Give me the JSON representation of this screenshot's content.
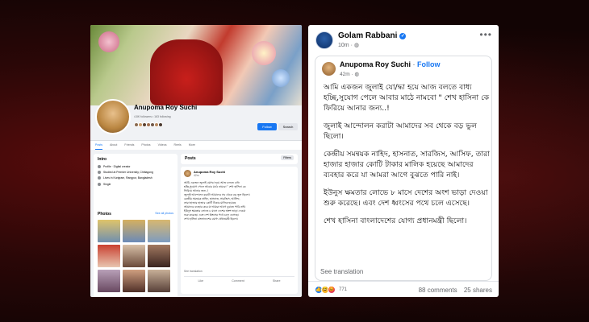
{
  "left_profile": {
    "name": "Anupoma Roy Suchi",
    "stats": "4.8K followers • 163 following",
    "follow_label": "Follow",
    "search_label": "Search",
    "tabs": [
      "Posts",
      "About",
      "Friends",
      "Photos",
      "Videos",
      "Reels",
      "More"
    ],
    "intro": {
      "title": "Intro",
      "items": [
        "Profile · Digital creator",
        "Studied at Premier University, Chittagong",
        "Lives in Kurigram, Rangpur, Bangladesh",
        "Single"
      ]
    },
    "photos": {
      "title": "Photos",
      "see_all": "See all photos"
    },
    "posts_title": "Posts",
    "filters_label": "Filters",
    "mini_post": {
      "author": "Anupoma Roy Suchi",
      "time": "42m",
      "lines": [
        "আমি একজন জুলাই যো/দ্ধা হয়ে আজ বলতে বাধ্য",
        "হচ্ছি,সুযোগ পেলে আবার মাঠে নামবো \" শেখ হাসিনা কে",
        "ফিরিয়ে আনার জন্য..!",
        "জুলাই আন্দোলন করাটা আমাদের সব থেকে বড় ভুল ছিলো।",
        "কেন্দ্রীয় সমন্বয়ক নাহিদ, হাসনাত, সারজিস, আসিফ,",
        "তারা হাজার হাজার কোটি টাকার মালিক হয়েছে",
        "আমাদের ব্যবহার করে যা আমরা আগে বুঝতে পারি নাই।",
        "ইউনুস ক্ষমতার লোভে ৮ মাসে দেশের অংশ ভাড়া দেওয়া",
        "শুরু করেছে। এবং দেশ ধ্বংসের পথে চলে এসেছে।",
        "শেখ হাসিনা বাংলাদেশের যোগ্য প্রধানমন্ত্রী ছিলো।"
      ],
      "see_translation": "See translation",
      "actions": [
        "Like",
        "Comment",
        "Share"
      ]
    }
  },
  "right_post": {
    "sharer": "Golam Rabbani",
    "time": "10m",
    "more_icon": "ellipsis-icon",
    "shared": {
      "author": "Anupoma Roy Suchi",
      "follow": "Follow",
      "time": "42m",
      "paragraphs": [
        "আমি একজন জুলাই যো/দ্ধা হয়ে আজ বলতে বাধ্য হচ্ছি,সুযোগ পেলে আবার মাঠে নামবো \" শেখ হাসিনা কে ফিরিয়ে আনার জন্য..!",
        "জুলাই আন্দোলন করাটা আমাদের সব থেকে বড় ভুল ছিলো।",
        "কেন্দ্রীয় সমন্বয়ক নাহিদ, হাসনাত, সারজিস, আসিফ, তারা হাজার হাজার কোটি টাকার মালিক হয়েছে আমাদের ব্যবহার করে যা আমরা আগে বুঝতে পারি নাই।",
        "ইউনুস ক্ষমতার লোভে ৮ মাসে দেশের অংশ ভাড়া দেওয়া শুরু করেছে। এবং দেশ ধ্বংসের পথে চলে এসেছে।",
        "শেখ হাসিনা বাংলাদেশের যোগ্য প্রধানমন্ত্রী ছিলো।"
      ],
      "see_translation": "See translation"
    },
    "reactions_count": "771",
    "comments": "88 comments",
    "shares": "25 shares"
  },
  "colors": {
    "fb_blue": "#1877f2",
    "bg_red": "#4a0b0b"
  }
}
